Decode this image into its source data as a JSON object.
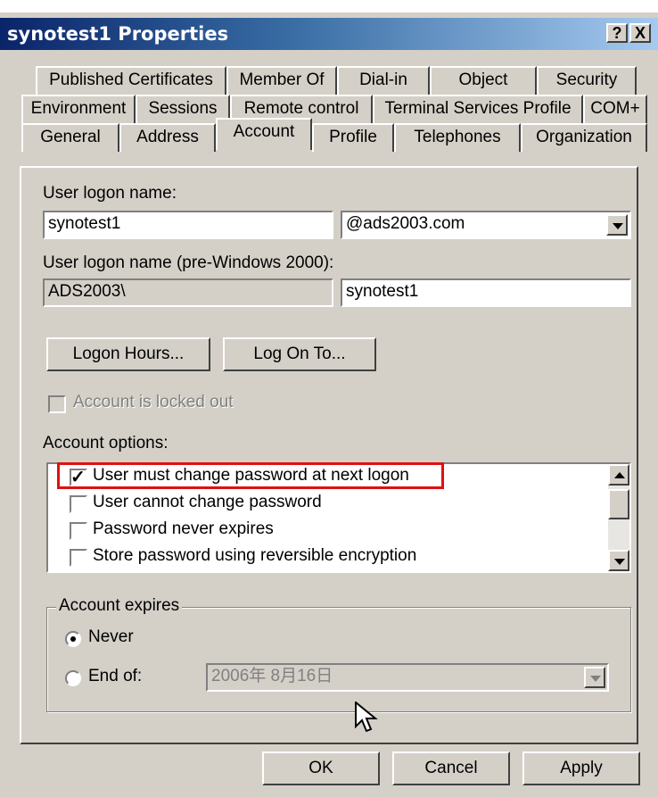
{
  "window": {
    "title": "synotest1 Properties",
    "help_label": "?",
    "close_label": "X"
  },
  "tabs": {
    "row1": [
      "Published Certificates",
      "Member Of",
      "Dial-in",
      "Object",
      "Security"
    ],
    "row2": [
      "Environment",
      "Sessions",
      "Remote control",
      "Terminal Services Profile",
      "COM+"
    ],
    "row3": [
      "General",
      "Address",
      "Account",
      "Profile",
      "Telephones",
      "Organization"
    ],
    "active": "Account"
  },
  "account": {
    "logon_name_label": "User logon name:",
    "logon_name_value": "synotest1",
    "domain_value": "@ads2003.com",
    "pre2000_label": "User logon name (pre-Windows 2000):",
    "pre2000_domain": "ADS2003\\",
    "pre2000_user": "synotest1",
    "logon_hours_label": "Logon Hours...",
    "log_on_to_label": "Log On To...",
    "locked_out_label": "Account is locked out",
    "options_label": "Account options:",
    "options": [
      {
        "label": "User must change password at next logon",
        "checked": true
      },
      {
        "label": "User cannot change password",
        "checked": false
      },
      {
        "label": "Password never expires",
        "checked": false
      },
      {
        "label": "Store password using reversible encryption",
        "checked": false
      }
    ],
    "expires_title": "Account expires",
    "never_label": "Never",
    "end_of_label": "End of:",
    "end_of_date": "2006年  8月16日",
    "expires_selected": "Never"
  },
  "buttons": {
    "ok": "OK",
    "cancel": "Cancel",
    "apply": "Apply"
  },
  "colors": {
    "title_bar": "#0a246a",
    "face": "#d4d0c8",
    "highlight_box": "#e01010"
  }
}
